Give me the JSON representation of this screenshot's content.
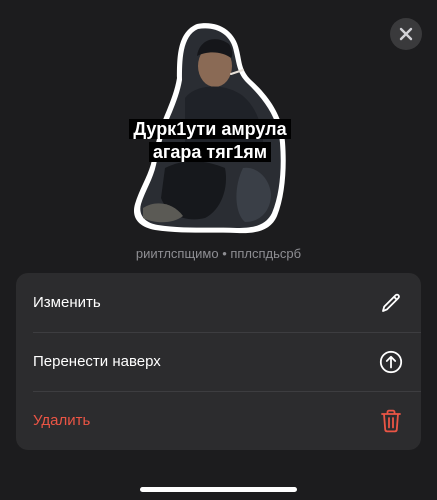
{
  "sticker": {
    "caption_line1": "Дурк1ути амрула",
    "caption_line2": "агара тяг1ям"
  },
  "pack_info": "риитлспщимо • пплспдьсрб",
  "menu": {
    "items": [
      {
        "label": "Изменить",
        "icon": "pencil-icon"
      },
      {
        "label": "Перенести наверх",
        "icon": "arrow-up-circle-icon"
      },
      {
        "label": "Удалить",
        "icon": "trash-icon"
      }
    ]
  },
  "colors": {
    "background": "#1c1c1e",
    "menu_background": "#2c2c2e",
    "danger": "#eb5545",
    "secondary_text": "#8e8e93"
  }
}
